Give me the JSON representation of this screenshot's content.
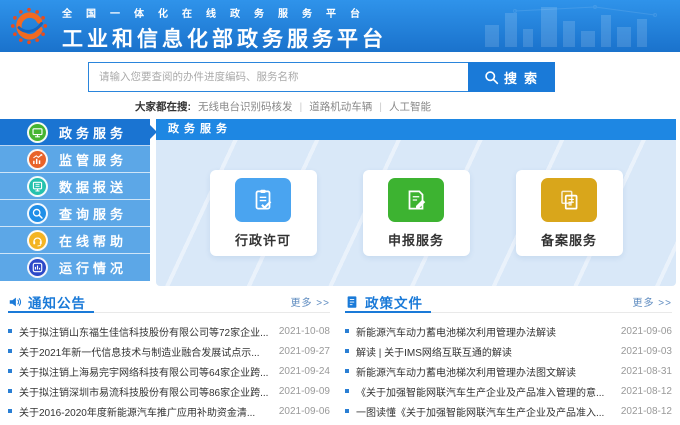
{
  "header": {
    "tagline": "全国一体化在线政务服务平台",
    "title": "工业和信息化部政务服务平台"
  },
  "search": {
    "placeholder": "请输入您要查阅的办件进度编码、服务名称",
    "button_label": "搜索",
    "hot_label": "大家都在搜:",
    "separator": "|",
    "hot_items": [
      "无线电台识别码核发",
      "道路机动车辆",
      "人工智能"
    ]
  },
  "sidebar": {
    "items": [
      {
        "label": "政务服务",
        "icon": "monitor-icon",
        "icon_color": "#45b531",
        "active": true
      },
      {
        "label": "监管服务",
        "icon": "bar-chart-icon",
        "icon_color": "#e8632a",
        "active": false
      },
      {
        "label": "数据报送",
        "icon": "data-report-icon",
        "icon_color": "#26c2ae",
        "active": false
      },
      {
        "label": "查询服务",
        "icon": "magnifier-icon",
        "icon_color": "#1f8fe8",
        "active": false
      },
      {
        "label": "在线帮助",
        "icon": "headset-icon",
        "icon_color": "#f3b424",
        "active": false
      },
      {
        "label": "运行情况",
        "icon": "dashboard-icon",
        "icon_color": "#2d49c8",
        "active": false
      }
    ]
  },
  "main_panel": {
    "title": "政务服务",
    "cards": [
      {
        "label": "行政许可",
        "icon": "clipboard-check-icon",
        "icon_color": "#4aa4f0"
      },
      {
        "label": "申报服务",
        "icon": "document-edit-icon",
        "icon_color": "#3db331"
      },
      {
        "label": "备案服务",
        "icon": "copy-files-icon",
        "icon_color": "#d9a61b"
      }
    ]
  },
  "notices": {
    "title": "通知公告",
    "more_label": "更多 >>",
    "items": [
      {
        "text": "关于拟注销山东福生佳信科技股份有限公司等72家企业...",
        "date": "2021-10-08"
      },
      {
        "text": "关于2021年新一代信息技术与制造业融合发展试点示...",
        "date": "2021-09-27"
      },
      {
        "text": "关于拟注销上海易完宇网络科技有限公司等64家企业跨...",
        "date": "2021-09-24"
      },
      {
        "text": "关于拟注销深圳市易流科技股份有限公司等86家企业跨...",
        "date": "2021-09-09"
      },
      {
        "text": "关于2016-2020年度新能源汽车推广应用补助资金清...",
        "date": "2021-09-06"
      }
    ]
  },
  "policies": {
    "title": "政策文件",
    "more_label": "更多 >>",
    "items": [
      {
        "text": "新能源汽车动力蓄电池梯次利用管理办法解读",
        "date": "2021-09-06"
      },
      {
        "text": "解读 | 关于IMS网络互联互通的解读",
        "date": "2021-09-03"
      },
      {
        "text": "新能源汽车动力蓄电池梯次利用管理办法图文解读",
        "date": "2021-08-31"
      },
      {
        "text": "《关于加强智能网联汽车生产企业及产品准入管理的意...",
        "date": "2021-08-12"
      },
      {
        "text": "一图读懂《关于加强智能网联汽车生产企业及产品准入...",
        "date": "2021-08-12"
      }
    ]
  },
  "theme": {
    "primary_blue": "#1a7ad8",
    "header_gradient_top": "#2f93ea",
    "header_gradient_bottom": "#1a72cc",
    "sidebar_item_bg": "#5ca7e7",
    "sidebar_active_bg": "#1a74d2",
    "panel_title_bg": "#1e87e3",
    "panel_body_bg": "#d9e8f8",
    "date_color": "#999999",
    "text_color": "#333333"
  }
}
